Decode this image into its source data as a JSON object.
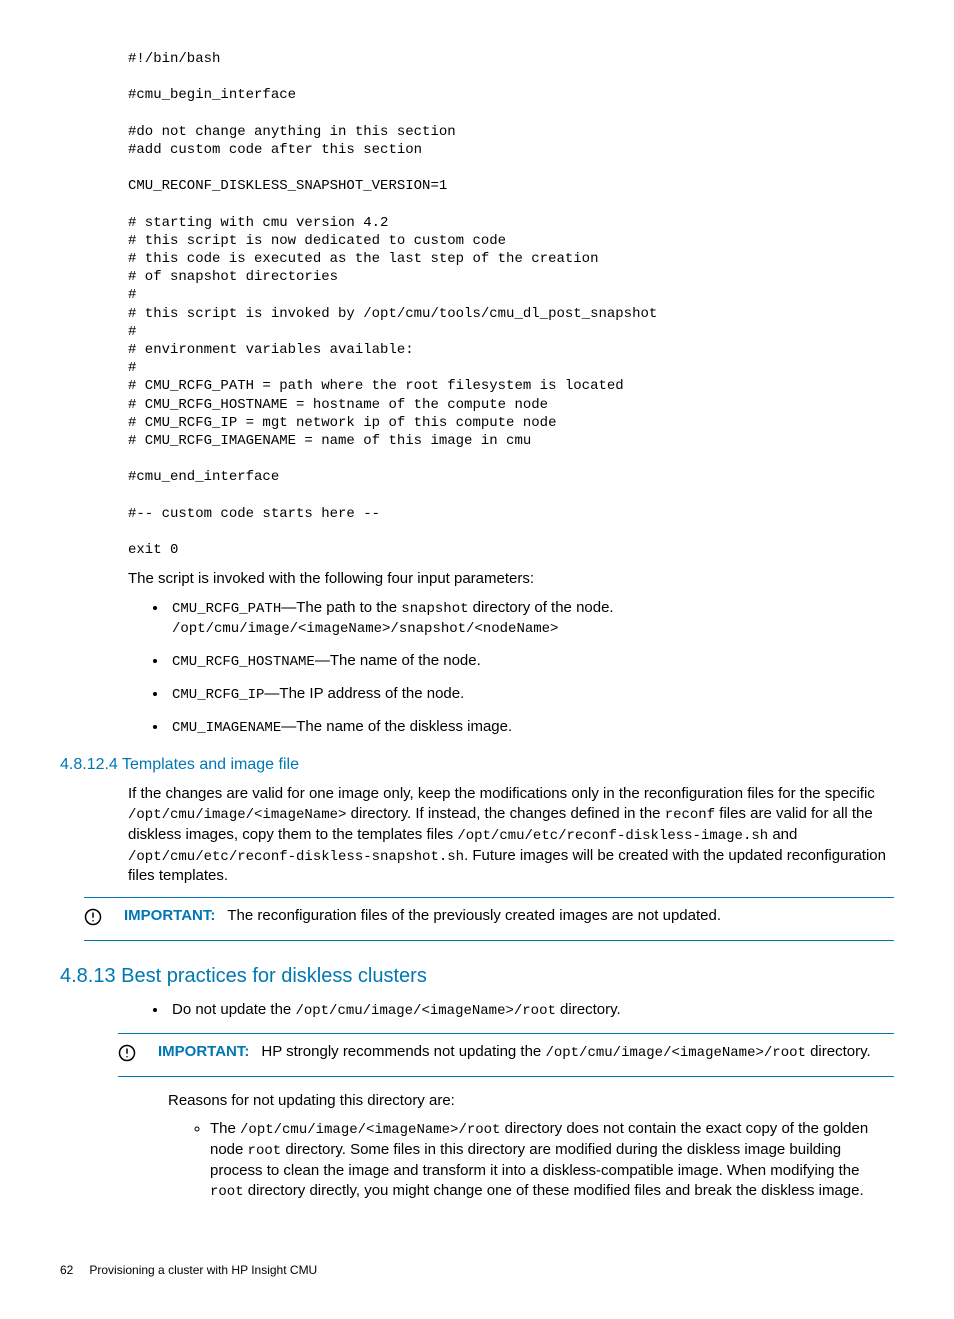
{
  "code_block": "#!/bin/bash\n\n#cmu_begin_interface\n\n#do not change anything in this section\n#add custom code after this section\n\nCMU_RECONF_DISKLESS_SNAPSHOT_VERSION=1\n\n# starting with cmu version 4.2\n# this script is now dedicated to custom code\n# this code is executed as the last step of the creation\n# of snapshot directories\n#\n# this script is invoked by /opt/cmu/tools/cmu_dl_post_snapshot\n#\n# environment variables available:\n#\n# CMU_RCFG_PATH = path where the root filesystem is located\n# CMU_RCFG_HOSTNAME = hostname of the compute node\n# CMU_RCFG_IP = mgt network ip of this compute node\n# CMU_RCFG_IMAGENAME = name of this image in cmu\n\n#cmu_end_interface\n\n#-- custom code starts here --\n\nexit 0",
  "intro": "The script is invoked with the following four input parameters:",
  "params": {
    "p1_code": "CMU_RCFG_PATH",
    "p1_a": "—The path to the ",
    "p1_code2": "snapshot",
    "p1_b": " directory of the node. ",
    "p1_code3": "/opt/cmu/image/<imageName>/snapshot/<nodeName>",
    "p2_code": "CMU_RCFG_HOSTNAME",
    "p2_t": "—The name of the node.",
    "p3_code": "CMU_RCFG_IP",
    "p3_t": "—The IP address of the node.",
    "p4_code": "CMU_IMAGENAME",
    "p4_t": "—The name of the diskless image."
  },
  "h_4_8_12_4": "4.8.12.4 Templates and image file",
  "tmpl": {
    "a": "If the changes are valid for one image only, keep the modifications only in the reconfiguration files for the specific ",
    "c1": "/opt/cmu/image/<imageName>",
    "b": " directory. If instead, the changes defined in the ",
    "c2": "reconf",
    "c": " files are valid for all the diskless images, copy them to the templates files ",
    "c3": "/opt/cmu/etc/reconf-diskless-image.sh",
    "d": " and ",
    "c4": "/opt/cmu/etc/reconf-diskless-snapshot.sh",
    "e": ". Future images will be created with the updated reconfiguration files templates."
  },
  "imp1_label": "IMPORTANT:",
  "imp1_text": "The reconfiguration files of the previously created images are not updated.",
  "h_4_8_13": "4.8.13 Best practices for diskless clusters",
  "bp1_a": "Do not update the ",
  "bp1_c": "/opt/cmu/image/<imageName>/root",
  "bp1_b": " directory.",
  "imp2_label": "IMPORTANT:",
  "imp2_a": "HP strongly recommends not updating the ",
  "imp2_c": "/opt/cmu/image/<imageName>/root",
  "imp2_b": " directory.",
  "reasons_intro": "Reasons for not updating this directory are:",
  "r1_a": "The ",
  "r1_c1": "/opt/cmu/image/<imageName>/root",
  "r1_b": " directory does not contain the exact copy of the golden node ",
  "r1_c2": "root",
  "r1_c": " directory. Some files in this directory are modified during the diskless image building process to clean the image and transform it into a diskless-compatible image. When modifying the ",
  "r1_c3": "root",
  "r1_d": " directory directly, you might change one of these modified files and break the diskless image.",
  "footer_page": "62",
  "footer_text": "Provisioning a cluster with HP Insight CMU"
}
